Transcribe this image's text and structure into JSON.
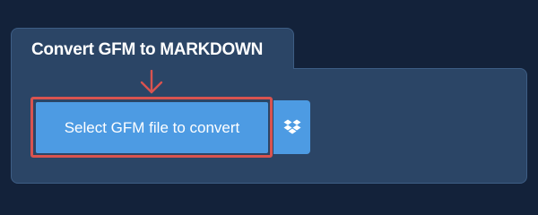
{
  "card": {
    "title": "Convert GFM to MARKDOWN"
  },
  "upload": {
    "select_label": "Select GFM file to convert",
    "dropbox_icon": "dropbox-icon"
  },
  "annotation": {
    "arrow_icon": "arrow-down-icon",
    "highlight_color": "#d9534f"
  },
  "colors": {
    "background": "#13223a",
    "card": "#2b4566",
    "button": "#4d9be3"
  }
}
